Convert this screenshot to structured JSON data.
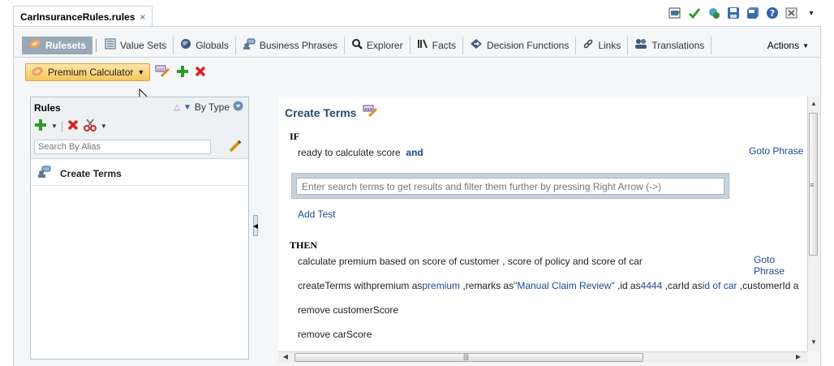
{
  "doc_tab": {
    "label": "CarInsuranceRules.rules",
    "close": "×"
  },
  "toolbar_icons": [
    "validate-icon",
    "checkmark-icon",
    "generate-icon",
    "save-icon",
    "save-all-icon",
    "help-icon",
    "close-panel-icon",
    "dropdown-icon"
  ],
  "nav": {
    "items": [
      {
        "label": "Rulesets",
        "icon": "rulesets-icon",
        "active": true
      },
      {
        "label": "Value Sets",
        "icon": "value-sets-icon"
      },
      {
        "label": "Globals",
        "icon": "globals-icon"
      },
      {
        "label": "Business Phrases",
        "icon": "business-phrases-icon"
      },
      {
        "label": "Explorer",
        "icon": "search-icon"
      },
      {
        "label": "Facts",
        "icon": "facts-icon"
      },
      {
        "label": "Decision Functions",
        "icon": "decision-functions-icon"
      },
      {
        "label": "Links",
        "icon": "links-icon"
      },
      {
        "label": "Translations",
        "icon": "translations-icon"
      }
    ],
    "actions": "Actions"
  },
  "ruleset": {
    "selected": "Premium Calculator"
  },
  "left": {
    "title": "Rules",
    "sort_label": "By Type",
    "search_placeholder": "Search By Alias",
    "rules": [
      {
        "label": "Create Terms",
        "icon": "rule-icon"
      }
    ]
  },
  "right": {
    "title": "Create Terms",
    "if_label": "IF",
    "condition": "ready to calculate score",
    "condition_op": "and",
    "goto1": "Goto Phrase",
    "search_placeholder": "Enter search terms to get results and filter them further by pressing Right Arrow (->)",
    "add_test": "Add Test",
    "then_label": "THEN",
    "action1": "calculate premium based on score of customer , score of policy and score of car",
    "goto2": "Goto Phrase",
    "action2": {
      "p1": "createTerms withpremium as",
      "h1": "premium",
      "p2": " ,remarks as",
      "h2": "\"Manual Claim Review\"",
      "p3": " ,id as",
      "h3": "4444",
      "p4": " ,carId as",
      "h4": "id of car",
      "p5": " ,customerId a"
    },
    "action3": "remove customerScore",
    "action4": "remove carScore"
  },
  "colors": {
    "accent": "#294a72",
    "link": "#1c4a8c",
    "active_tab": "#9aa8b8",
    "ruleset_select": "#f4c65b"
  }
}
